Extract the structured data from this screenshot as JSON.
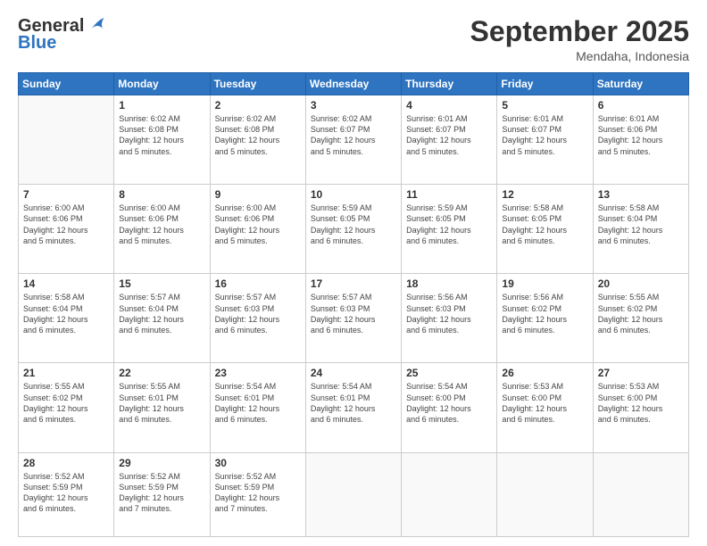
{
  "header": {
    "logo_line1": "General",
    "logo_line2": "Blue",
    "month": "September 2025",
    "location": "Mendaha, Indonesia"
  },
  "days_of_week": [
    "Sunday",
    "Monday",
    "Tuesday",
    "Wednesday",
    "Thursday",
    "Friday",
    "Saturday"
  ],
  "weeks": [
    [
      {
        "day": "",
        "info": ""
      },
      {
        "day": "1",
        "info": "Sunrise: 6:02 AM\nSunset: 6:08 PM\nDaylight: 12 hours\nand 5 minutes."
      },
      {
        "day": "2",
        "info": "Sunrise: 6:02 AM\nSunset: 6:08 PM\nDaylight: 12 hours\nand 5 minutes."
      },
      {
        "day": "3",
        "info": "Sunrise: 6:02 AM\nSunset: 6:07 PM\nDaylight: 12 hours\nand 5 minutes."
      },
      {
        "day": "4",
        "info": "Sunrise: 6:01 AM\nSunset: 6:07 PM\nDaylight: 12 hours\nand 5 minutes."
      },
      {
        "day": "5",
        "info": "Sunrise: 6:01 AM\nSunset: 6:07 PM\nDaylight: 12 hours\nand 5 minutes."
      },
      {
        "day": "6",
        "info": "Sunrise: 6:01 AM\nSunset: 6:06 PM\nDaylight: 12 hours\nand 5 minutes."
      }
    ],
    [
      {
        "day": "7",
        "info": "Sunrise: 6:00 AM\nSunset: 6:06 PM\nDaylight: 12 hours\nand 5 minutes."
      },
      {
        "day": "8",
        "info": "Sunrise: 6:00 AM\nSunset: 6:06 PM\nDaylight: 12 hours\nand 5 minutes."
      },
      {
        "day": "9",
        "info": "Sunrise: 6:00 AM\nSunset: 6:06 PM\nDaylight: 12 hours\nand 5 minutes."
      },
      {
        "day": "10",
        "info": "Sunrise: 5:59 AM\nSunset: 6:05 PM\nDaylight: 12 hours\nand 6 minutes."
      },
      {
        "day": "11",
        "info": "Sunrise: 5:59 AM\nSunset: 6:05 PM\nDaylight: 12 hours\nand 6 minutes."
      },
      {
        "day": "12",
        "info": "Sunrise: 5:58 AM\nSunset: 6:05 PM\nDaylight: 12 hours\nand 6 minutes."
      },
      {
        "day": "13",
        "info": "Sunrise: 5:58 AM\nSunset: 6:04 PM\nDaylight: 12 hours\nand 6 minutes."
      }
    ],
    [
      {
        "day": "14",
        "info": "Sunrise: 5:58 AM\nSunset: 6:04 PM\nDaylight: 12 hours\nand 6 minutes."
      },
      {
        "day": "15",
        "info": "Sunrise: 5:57 AM\nSunset: 6:04 PM\nDaylight: 12 hours\nand 6 minutes."
      },
      {
        "day": "16",
        "info": "Sunrise: 5:57 AM\nSunset: 6:03 PM\nDaylight: 12 hours\nand 6 minutes."
      },
      {
        "day": "17",
        "info": "Sunrise: 5:57 AM\nSunset: 6:03 PM\nDaylight: 12 hours\nand 6 minutes."
      },
      {
        "day": "18",
        "info": "Sunrise: 5:56 AM\nSunset: 6:03 PM\nDaylight: 12 hours\nand 6 minutes."
      },
      {
        "day": "19",
        "info": "Sunrise: 5:56 AM\nSunset: 6:02 PM\nDaylight: 12 hours\nand 6 minutes."
      },
      {
        "day": "20",
        "info": "Sunrise: 5:55 AM\nSunset: 6:02 PM\nDaylight: 12 hours\nand 6 minutes."
      }
    ],
    [
      {
        "day": "21",
        "info": "Sunrise: 5:55 AM\nSunset: 6:02 PM\nDaylight: 12 hours\nand 6 minutes."
      },
      {
        "day": "22",
        "info": "Sunrise: 5:55 AM\nSunset: 6:01 PM\nDaylight: 12 hours\nand 6 minutes."
      },
      {
        "day": "23",
        "info": "Sunrise: 5:54 AM\nSunset: 6:01 PM\nDaylight: 12 hours\nand 6 minutes."
      },
      {
        "day": "24",
        "info": "Sunrise: 5:54 AM\nSunset: 6:01 PM\nDaylight: 12 hours\nand 6 minutes."
      },
      {
        "day": "25",
        "info": "Sunrise: 5:54 AM\nSunset: 6:00 PM\nDaylight: 12 hours\nand 6 minutes."
      },
      {
        "day": "26",
        "info": "Sunrise: 5:53 AM\nSunset: 6:00 PM\nDaylight: 12 hours\nand 6 minutes."
      },
      {
        "day": "27",
        "info": "Sunrise: 5:53 AM\nSunset: 6:00 PM\nDaylight: 12 hours\nand 6 minutes."
      }
    ],
    [
      {
        "day": "28",
        "info": "Sunrise: 5:52 AM\nSunset: 5:59 PM\nDaylight: 12 hours\nand 6 minutes."
      },
      {
        "day": "29",
        "info": "Sunrise: 5:52 AM\nSunset: 5:59 PM\nDaylight: 12 hours\nand 7 minutes."
      },
      {
        "day": "30",
        "info": "Sunrise: 5:52 AM\nSunset: 5:59 PM\nDaylight: 12 hours\nand 7 minutes."
      },
      {
        "day": "",
        "info": ""
      },
      {
        "day": "",
        "info": ""
      },
      {
        "day": "",
        "info": ""
      },
      {
        "day": "",
        "info": ""
      }
    ]
  ]
}
